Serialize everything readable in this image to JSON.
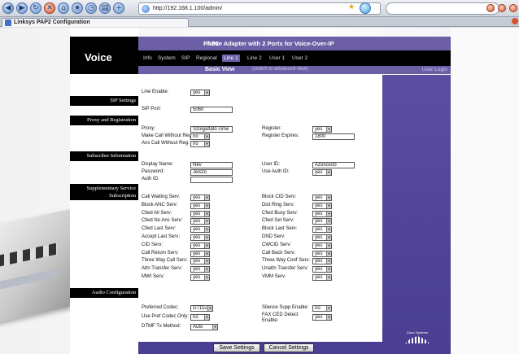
{
  "browser": {
    "url": "http://192.168.1.100/admin/",
    "tab_title": "Linksys PAP2 Configuration"
  },
  "header": {
    "brand": "Voice",
    "title": "Phone Adapter with 2 Ports for Voice-Over-IP",
    "model": "PAP2",
    "tabs": [
      {
        "label": "Info",
        "active": false
      },
      {
        "label": "System",
        "active": false
      },
      {
        "label": "SIP",
        "active": false
      },
      {
        "label": "Regional",
        "active": false
      },
      {
        "label": "Line 1",
        "active": true
      },
      {
        "label": "Line 2",
        "active": false
      },
      {
        "label": "User 1",
        "active": false
      },
      {
        "label": "User 2",
        "active": false
      }
    ],
    "basic_view": "Basic View",
    "switch_view": "(switch to advanced view)",
    "user_login": "User Login"
  },
  "sections": {
    "sip": "SIP Settings",
    "proxy": "Proxy and Registration",
    "subscriber": "Subscriber Information",
    "supplementary": "Supplementary Service Subscription",
    "audio": "Audio Configuration"
  },
  "fields": {
    "line_enable": {
      "label": "Line Enable:",
      "value": "yes"
    },
    "sip_port": {
      "label": "SIP Port:",
      "value": "5060"
    },
    "proxy": {
      "label": "Proxy:",
      "value": "Szolgáltató címe"
    },
    "register": {
      "label": "Register:",
      "value": "yes"
    },
    "make_call": {
      "label": "Make Call Without Reg:",
      "value": "no"
    },
    "register_expires": {
      "label": "Register Expires:",
      "value": "1800"
    },
    "ans_call": {
      "label": "Ans Call Without Reg:",
      "value": "no"
    },
    "display_name": {
      "label": "Display Name:",
      "value": "Név"
    },
    "user_id": {
      "label": "User ID:",
      "value": "Azonosító"
    },
    "password": {
      "label": "Password:",
      "value": "Jelszó"
    },
    "use_auth_id": {
      "label": "Use Auth ID:",
      "value": "yes"
    },
    "auth_id": {
      "label": "Auth ID:",
      "value": ""
    }
  },
  "supplementary": {
    "left": [
      {
        "label": "Call Waiting Serv:",
        "value": "yes"
      },
      {
        "label": "Block ANC Serv:",
        "value": "yes"
      },
      {
        "label": "Cfwd All Serv:",
        "value": "yes"
      },
      {
        "label": "Cfwd No Ans Serv:",
        "value": "yes"
      },
      {
        "label": "Cfwd Last Serv:",
        "value": "yes"
      },
      {
        "label": "Accept Last Serv:",
        "value": "yes"
      },
      {
        "label": "CID Serv:",
        "value": "yes"
      },
      {
        "label": "Call Return Serv:",
        "value": "yes"
      },
      {
        "label": "Three Way Call Serv:",
        "value": "yes"
      },
      {
        "label": "Attn Transfer Serv:",
        "value": "yes"
      },
      {
        "label": "MWI Serv:",
        "value": "yes"
      }
    ],
    "right": [
      {
        "label": "Block CID Serv:",
        "value": "yes"
      },
      {
        "label": "Dist Ring Serv:",
        "value": "yes"
      },
      {
        "label": "Cfwd Busy Serv:",
        "value": "yes"
      },
      {
        "label": "Cfwd Sel Serv:",
        "value": "yes"
      },
      {
        "label": "Block Last Serv:",
        "value": "yes"
      },
      {
        "label": "DND Serv:",
        "value": "yes"
      },
      {
        "label": "CWCID Serv:",
        "value": "yes"
      },
      {
        "label": "Call Back Serv:",
        "value": "yes"
      },
      {
        "label": "Three Way Conf Serv:",
        "value": "yes"
      },
      {
        "label": "Unattn Transfer Serv:",
        "value": "yes"
      },
      {
        "label": "VMM Serv:",
        "value": "yes"
      }
    ]
  },
  "audio": {
    "preferred_codec": {
      "label": "Preferred Codec:",
      "value": "G711u"
    },
    "silence_supp": {
      "label": "Silence Supp Enable:",
      "value": "no"
    },
    "use_pref_codec": {
      "label": "Use Pref Codec Only:",
      "value": "no"
    },
    "fax_ced": {
      "label": "FAX CED Detect Enable:",
      "value": "yes"
    },
    "dtmf": {
      "label": "DTMF Tx Method:",
      "value": "Auto"
    }
  },
  "buttons": {
    "save": "Save Settings",
    "cancel": "Cancel Settings"
  },
  "footer_logo": "Cisco Systems",
  "colors": {
    "accent": "#6c5fa6",
    "dark_purple": "#4a3e92",
    "header_bg": "#000000"
  }
}
